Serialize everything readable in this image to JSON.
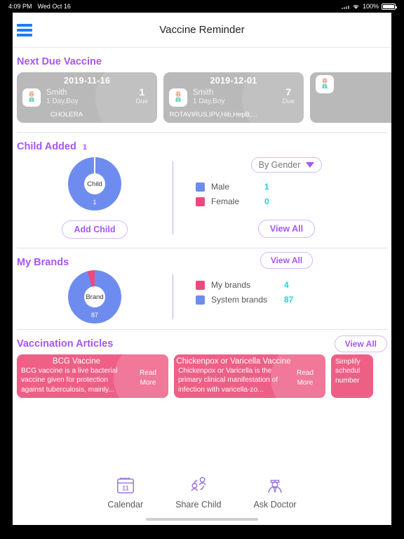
{
  "status_bar": {
    "time": "4:09 PM",
    "date": "Wed Oct 16",
    "battery_percent": "100%",
    "wifi_icon": "wifi-icon",
    "battery_icon": "battery-icon"
  },
  "nav": {
    "menu_icon": "hamburger-menu-icon",
    "title": "Vaccine Reminder"
  },
  "next_due": {
    "section_title": "Next Due Vaccine",
    "due_label": "Due",
    "cards": [
      {
        "date": "2019-11-16",
        "name": "Smith",
        "age": "1 Day,Boy",
        "vaccines": "CHOLERA",
        "count": "1",
        "due_label": "Due"
      },
      {
        "date": "2019-12-01",
        "name": "Smith",
        "age": "1 Day,Boy",
        "vaccines": "ROTAVIRUS,IPV,Hib,HepB,...",
        "count": "7",
        "due_label": "Due"
      },
      {
        "date": "",
        "name": "",
        "age": "",
        "vaccines": "",
        "count": "",
        "due_label": ""
      }
    ]
  },
  "child_added": {
    "section_title": "Child Added",
    "count": "1",
    "donut_center_label": "Child",
    "donut_value_label": "1",
    "filter_label": "By Gender",
    "add_child_label": "Add Child",
    "view_all_label": "View All",
    "legend": [
      {
        "label": "Male",
        "value": "1",
        "color": "#6e8cf0"
      },
      {
        "label": "Female",
        "value": "0",
        "color": "#ec4a7f"
      }
    ]
  },
  "my_brands": {
    "section_title": "My Brands",
    "donut_center_label": "Brand",
    "donut_value_label": "87",
    "view_all_label": "View All",
    "legend": [
      {
        "label": "My brands",
        "value": "4",
        "color": "#ec4a7f"
      },
      {
        "label": "System brands",
        "value": "87",
        "color": "#6e8cf0"
      }
    ]
  },
  "articles": {
    "section_title": "Vaccination Articles",
    "view_all_label": "View All",
    "read_more_label": "Read\nMore",
    "items": [
      {
        "title": "BCG Vaccine",
        "body": "BCG vaccine is a live bacterial vaccine given for protection against tuberculosis, mainly...",
        "read_more": "Read More"
      },
      {
        "title": "Chickenpox or Varicella Vaccine",
        "body": "Chickenpox or Varicella is the primary clinical manifestation of infection with varicella-zo...",
        "read_more": "Read More"
      },
      {
        "title": "",
        "body": "Simplify schedul number",
        "read_more": ""
      }
    ]
  },
  "bottom_nav": [
    {
      "label": "Calendar",
      "icon": "calendar-icon",
      "day": "11"
    },
    {
      "label": "Share Child",
      "icon": "share-child-icon"
    },
    {
      "label": "Ask Doctor",
      "icon": "ask-doctor-icon"
    }
  ],
  "colors": {
    "accent_purple": "#a855f7",
    "blue": "#6e8cf0",
    "pink": "#ec4a7f",
    "cyan": "#16d5e8",
    "card_gray": "#b9b9b9",
    "nav_blue": "#1a7cfa"
  }
}
